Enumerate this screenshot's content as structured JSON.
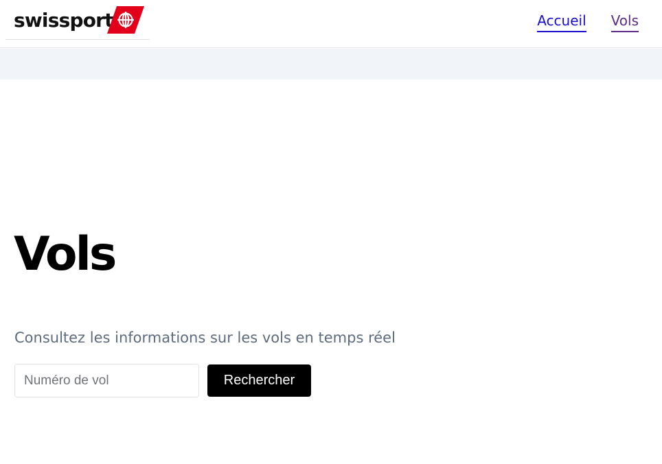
{
  "header": {
    "brand_name": "swissport",
    "nav": {
      "home_label": "Accueil",
      "flights_label": "Vols"
    }
  },
  "main": {
    "title": "Vols",
    "subtitle": "Consultez les informations sur les vols en temps réel",
    "search": {
      "placeholder": "Numéro de vol",
      "value": "",
      "button_label": "Rechercher"
    }
  },
  "colors": {
    "brand_red": "#e2001a",
    "link_unvisited": "#1a0dcc",
    "link_visited": "#5b2a86",
    "band_background": "#f1f4f8",
    "button_background": "#000000"
  },
  "icons": {
    "logo_mark": "swissport-globe-flag-icon"
  }
}
